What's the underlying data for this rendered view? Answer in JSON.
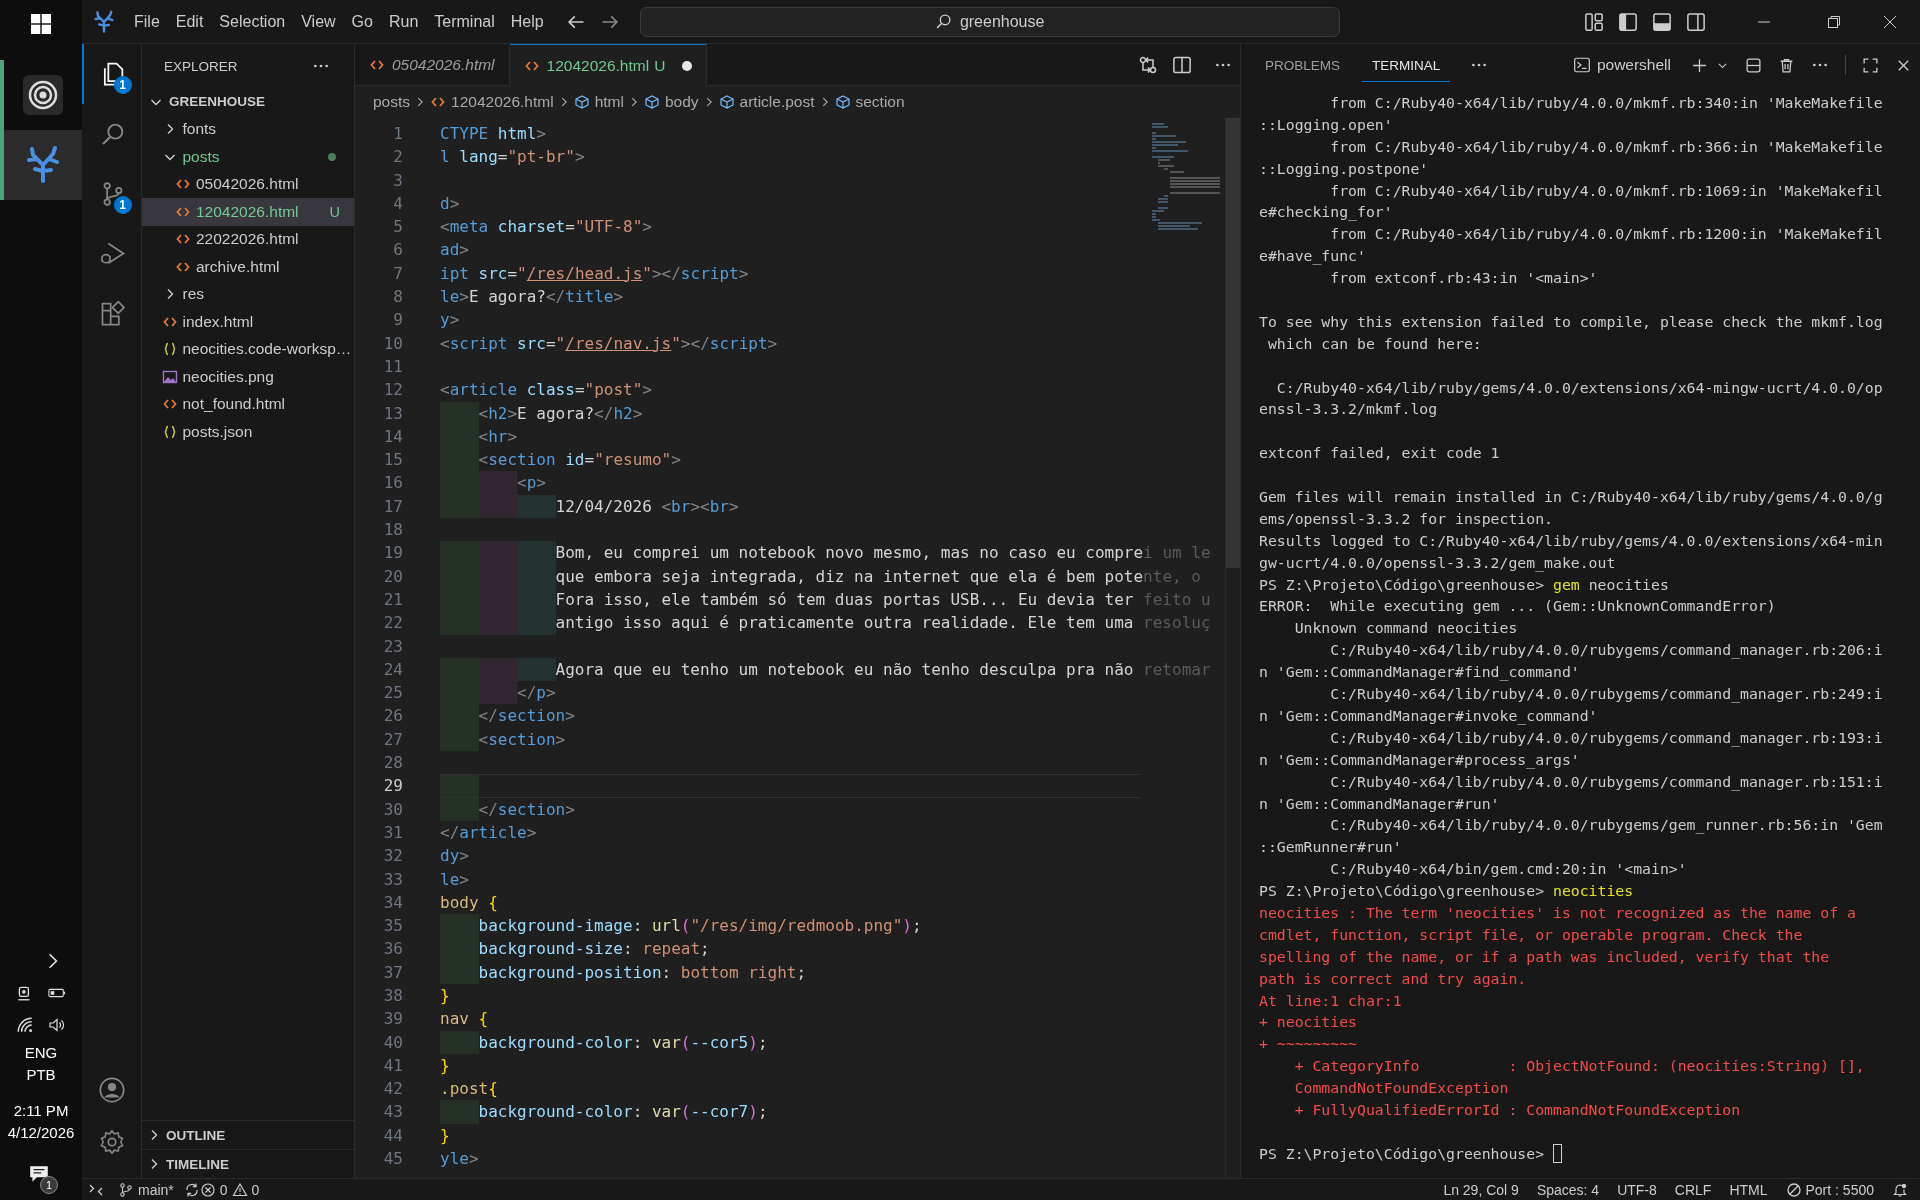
{
  "taskbar": {
    "apps": [
      {
        "kind": "rings",
        "active": false
      },
      {
        "kind": "coral",
        "active": true
      }
    ],
    "tray": {
      "language": "ENG",
      "layout": "PTB",
      "time": "2:11 PM",
      "date": "4/12/2026",
      "notifications": "1"
    }
  },
  "title_bar": {
    "menu": [
      "File",
      "Edit",
      "Selection",
      "View",
      "Go",
      "Run",
      "Terminal",
      "Help"
    ],
    "search": "greenhouse"
  },
  "activity_bar": {
    "items": [
      {
        "kind": "explorer",
        "selected": true,
        "badge": "1"
      },
      {
        "kind": "search",
        "selected": false
      },
      {
        "kind": "source-control",
        "selected": false,
        "badge": "1"
      },
      {
        "kind": "run",
        "selected": false
      },
      {
        "kind": "extensions",
        "selected": false
      }
    ]
  },
  "sidebar": {
    "title": "EXPLORER",
    "root": {
      "name": "GREENHOUSE",
      "expanded": true,
      "children": [
        {
          "name": "fonts",
          "kind": "folder",
          "expanded": false,
          "selected": false,
          "untracked": false
        },
        {
          "name": "posts",
          "kind": "folder",
          "expanded": true,
          "selected": false,
          "untracked": true,
          "children": [
            {
              "name": "05042026.html",
              "kind": "html",
              "selected": false,
              "untracked": false
            },
            {
              "name": "12042026.html",
              "kind": "html",
              "selected": true,
              "untracked": true,
              "badge": "U"
            },
            {
              "name": "22022026.html",
              "kind": "html",
              "selected": false,
              "untracked": false
            },
            {
              "name": "archive.html",
              "kind": "html",
              "selected": false,
              "untracked": false
            }
          ]
        },
        {
          "name": "res",
          "kind": "folder",
          "expanded": false,
          "selected": false,
          "untracked": false
        },
        {
          "name": "index.html",
          "kind": "html",
          "selected": false,
          "untracked": false
        },
        {
          "name": "neocities.code-worksp…",
          "kind": "json",
          "selected": false,
          "untracked": false
        },
        {
          "name": "neocities.png",
          "kind": "image",
          "selected": false,
          "untracked": false
        },
        {
          "name": "not_found.html",
          "kind": "html",
          "selected": false,
          "untracked": false
        },
        {
          "name": "posts.json",
          "kind": "json",
          "selected": false,
          "untracked": false
        }
      ]
    },
    "sections": [
      {
        "title": "OUTLINE",
        "expanded": false
      },
      {
        "title": "TIMELINE",
        "expanded": false
      }
    ]
  },
  "editor": {
    "tabs": [
      {
        "label": "05042026.html",
        "selected": false,
        "preview": true,
        "dirty": false
      },
      {
        "label": "12042026.html",
        "selected": true,
        "preview": false,
        "dirty": true,
        "status": "U"
      }
    ],
    "breadcrumbs": [
      {
        "label": "posts",
        "kind": "folder"
      },
      {
        "label": "12042026.html",
        "kind": "file"
      },
      {
        "label": "html",
        "kind": "symbol"
      },
      {
        "label": "body",
        "kind": "symbol"
      },
      {
        "label": "article.post",
        "kind": "symbol"
      },
      {
        "label": "section",
        "kind": "symbol"
      }
    ],
    "lines": [
      {
        "number": "1",
        "current": false,
        "tokens": [
          {
            "text": "CTYPE",
            "kind": "tag"
          },
          {
            "text": " html",
            "kind": "attr"
          },
          {
            "text": ">",
            "kind": "punct"
          }
        ]
      },
      {
        "number": "2",
        "current": false,
        "tokens": [
          {
            "text": "l",
            "kind": "tag"
          },
          {
            "text": " lang",
            "kind": "attr"
          },
          {
            "text": "=",
            "kind": "text"
          },
          {
            "text": "\"pt-br\"",
            "kind": "str"
          },
          {
            "text": ">",
            "kind": "punct"
          }
        ]
      },
      {
        "number": "3",
        "current": false
      },
      {
        "number": "4",
        "current": false,
        "tokens": [
          {
            "text": "d",
            "kind": "tag"
          },
          {
            "text": ">",
            "kind": "punct"
          }
        ]
      },
      {
        "number": "5",
        "current": false,
        "tokens": [
          {
            "text": "<",
            "kind": "punct"
          },
          {
            "text": "meta",
            "kind": "tag"
          },
          {
            "text": " charset",
            "kind": "attr"
          },
          {
            "text": "=",
            "kind": "text"
          },
          {
            "text": "\"UTF-8\"",
            "kind": "str"
          },
          {
            "text": ">",
            "kind": "punct"
          }
        ]
      },
      {
        "number": "6",
        "current": false,
        "tokens": [
          {
            "text": "ad",
            "kind": "tag"
          },
          {
            "text": ">",
            "kind": "punct"
          }
        ]
      },
      {
        "number": "7",
        "current": false,
        "tokens": [
          {
            "text": "ipt",
            "kind": "tag"
          },
          {
            "text": " src",
            "kind": "attr"
          },
          {
            "text": "=",
            "kind": "text"
          },
          {
            "text": "\"",
            "kind": "str"
          },
          {
            "text": "/res/head.js",
            "kind": "link"
          },
          {
            "text": "\"",
            "kind": "str"
          },
          {
            "text": "></",
            "kind": "punct"
          },
          {
            "text": "script",
            "kind": "tag"
          },
          {
            "text": ">",
            "kind": "punct"
          }
        ]
      },
      {
        "number": "8",
        "current": false,
        "tokens": [
          {
            "text": "le",
            "kind": "tag"
          },
          {
            "text": ">",
            "kind": "punct"
          },
          {
            "text": "E agora?",
            "kind": "text"
          },
          {
            "text": "</",
            "kind": "punct"
          },
          {
            "text": "title",
            "kind": "tag"
          },
          {
            "text": ">",
            "kind": "punct"
          }
        ]
      },
      {
        "number": "9",
        "current": false,
        "tokens": [
          {
            "text": "y",
            "kind": "tag"
          },
          {
            "text": ">",
            "kind": "punct"
          }
        ]
      },
      {
        "number": "10",
        "current": false,
        "tokens": [
          {
            "text": "<",
            "kind": "punct"
          },
          {
            "text": "script",
            "kind": "tag"
          },
          {
            "text": " src",
            "kind": "attr"
          },
          {
            "text": "=",
            "kind": "text"
          },
          {
            "text": "\"",
            "kind": "str"
          },
          {
            "text": "/res/nav.js",
            "kind": "link"
          },
          {
            "text": "\"",
            "kind": "str"
          },
          {
            "text": "></",
            "kind": "punct"
          },
          {
            "text": "script",
            "kind": "tag"
          },
          {
            "text": ">",
            "kind": "punct"
          }
        ]
      },
      {
        "number": "11",
        "current": false
      },
      {
        "number": "12",
        "current": false,
        "tokens": [
          {
            "text": "<",
            "kind": "punct"
          },
          {
            "text": "article",
            "kind": "tag"
          },
          {
            "text": " class",
            "kind": "attr"
          },
          {
            "text": "=",
            "kind": "text"
          },
          {
            "text": "\"post\"",
            "kind": "str"
          },
          {
            "text": ">",
            "kind": "punct"
          }
        ],
        "children": [
          {
            "number": "13",
            "current": false,
            "tokens": [
              {
                "text": "<",
                "kind": "punct"
              },
              {
                "text": "h2",
                "kind": "tag"
              },
              {
                "text": ">",
                "kind": "punct"
              },
              {
                "text": "E agora?",
                "kind": "text"
              },
              {
                "text": "</",
                "kind": "punct"
              },
              {
                "text": "h2",
                "kind": "tag"
              },
              {
                "text": ">",
                "kind": "punct"
              }
            ]
          },
          {
            "number": "14",
            "current": false,
            "tokens": [
              {
                "text": "<",
                "kind": "punct"
              },
              {
                "text": "hr",
                "kind": "tag"
              },
              {
                "text": ">",
                "kind": "punct"
              }
            ]
          },
          {
            "number": "15",
            "current": false,
            "tokens": [
              {
                "text": "<",
                "kind": "punct"
              },
              {
                "text": "section",
                "kind": "tag"
              },
              {
                "text": " id",
                "kind": "attr"
              },
              {
                "text": "=",
                "kind": "text"
              },
              {
                "text": "\"resumo\"",
                "kind": "str"
              },
              {
                "text": ">",
                "kind": "punct"
              }
            ],
            "children": [
              {
                "number": "16",
                "current": false,
                "tokens": [
                  {
                    "text": "<",
                    "kind": "punct"
                  },
                  {
                    "text": "p",
                    "kind": "tag"
                  },
                  {
                    "text": ">",
                    "kind": "punct"
                  }
                ],
                "children": [
                  {
                    "number": "17",
                    "current": false,
                    "tokens": [
                      {
                        "text": "12/04/2026 ",
                        "kind": "text"
                      },
                      {
                        "text": "<",
                        "kind": "punct"
                      },
                      {
                        "text": "br",
                        "kind": "tag"
                      },
                      {
                        "text": "><",
                        "kind": "punct"
                      },
                      {
                        "text": "br",
                        "kind": "tag"
                      },
                      {
                        "text": ">",
                        "kind": "punct"
                      }
                    ]
                  },
                  {
                    "number": "18",
                    "current": false
                  },
                  {
                    "number": "19",
                    "current": false,
                    "tokens": [
                      {
                        "text": "Bom, eu comprei um notebook novo mesmo, mas no caso eu compre",
                        "kind": "text"
                      },
                      {
                        "text": "i um le",
                        "kind": "dim"
                      }
                    ]
                  },
                  {
                    "number": "20",
                    "current": false,
                    "tokens": [
                      {
                        "text": "que embora seja integrada, diz na internet que ela é bem pote",
                        "kind": "text"
                      },
                      {
                        "text": "nte, o",
                        "kind": "dim"
                      }
                    ]
                  },
                  {
                    "number": "21",
                    "current": false,
                    "tokens": [
                      {
                        "text": "Fora isso, ele também só tem duas portas USB... Eu devia ter",
                        "kind": "text"
                      },
                      {
                        "text": " feito u",
                        "kind": "dim"
                      }
                    ]
                  },
                  {
                    "number": "22",
                    "current": false,
                    "tokens": [
                      {
                        "text": "antigo isso aqui é praticamente outra realidade. Ele tem uma",
                        "kind": "text"
                      },
                      {
                        "text": " resoluç",
                        "kind": "dim"
                      }
                    ]
                  },
                  {
                    "number": "23",
                    "current": false
                  },
                  {
                    "number": "24",
                    "current": false,
                    "tokens": [
                      {
                        "text": "Agora que eu tenho um notebook eu não tenho desculpa pra não",
                        "kind": "text"
                      },
                      {
                        "text": " retomar",
                        "kind": "dim"
                      }
                    ]
                  }
                ]
              },
              {
                "number": "25",
                "current": false,
                "tokens": [
                  {
                    "text": "</",
                    "kind": "punct"
                  },
                  {
                    "text": "p",
                    "kind": "tag"
                  },
                  {
                    "text": ">",
                    "kind": "punct"
                  }
                ]
              }
            ]
          },
          {
            "number": "26",
            "current": false,
            "tokens": [
              {
                "text": "</",
                "kind": "punct"
              },
              {
                "text": "section",
                "kind": "tag"
              },
              {
                "text": ">",
                "kind": "punct"
              }
            ]
          },
          {
            "number": "27",
            "current": false,
            "tokens": [
              {
                "text": "<",
                "kind": "punct"
              },
              {
                "text": "section",
                "kind": "tag"
              },
              {
                "text": ">",
                "kind": "punct"
              }
            ]
          },
          {
            "number": "28",
            "current": false
          },
          {
            "number": "29",
            "current": true
          },
          {
            "number": "30",
            "current": false,
            "tokens": [
              {
                "text": "</",
                "kind": "punct"
              },
              {
                "text": "section",
                "kind": "tag"
              },
              {
                "text": ">",
                "kind": "punct"
              }
            ]
          }
        ]
      },
      {
        "number": "31",
        "current": false,
        "tokens": [
          {
            "text": "</",
            "kind": "punct"
          },
          {
            "text": "article",
            "kind": "tag"
          },
          {
            "text": ">",
            "kind": "punct"
          }
        ]
      },
      {
        "number": "32",
        "current": false,
        "tokens": [
          {
            "text": "dy",
            "kind": "tag"
          },
          {
            "text": ">",
            "kind": "punct"
          }
        ]
      },
      {
        "number": "33",
        "current": false,
        "tokens": [
          {
            "text": "le",
            "kind": "tag"
          },
          {
            "text": ">",
            "kind": "punct"
          }
        ]
      },
      {
        "number": "34",
        "current": false,
        "tokens": [
          {
            "text": "body",
            "kind": "sel"
          },
          {
            "text": " {",
            "kind": "brace"
          }
        ],
        "children": [
          {
            "number": "35",
            "current": false,
            "tokens": [
              {
                "text": "background-image",
                "kind": "prop"
              },
              {
                "text": ": ",
                "kind": "text"
              },
              {
                "text": "url",
                "kind": "fn"
              },
              {
                "text": "(",
                "kind": "paren"
              },
              {
                "text": "\"/res/img/redmoob.png\"",
                "kind": "str"
              },
              {
                "text": ")",
                "kind": "paren"
              },
              {
                "text": ";",
                "kind": "text"
              }
            ]
          },
          {
            "number": "36",
            "current": false,
            "tokens": [
              {
                "text": "background-size",
                "kind": "prop"
              },
              {
                "text": ": ",
                "kind": "text"
              },
              {
                "text": "repeat",
                "kind": "str"
              },
              {
                "text": ";",
                "kind": "text"
              }
            ]
          },
          {
            "number": "37",
            "current": false,
            "tokens": [
              {
                "text": "background-position",
                "kind": "prop"
              },
              {
                "text": ": ",
                "kind": "text"
              },
              {
                "text": "bottom right",
                "kind": "str"
              },
              {
                "text": ";",
                "kind": "text"
              }
            ]
          }
        ]
      },
      {
        "number": "38",
        "current": false,
        "tokens": [
          {
            "text": "}",
            "kind": "brace"
          }
        ]
      },
      {
        "number": "39",
        "current": false,
        "tokens": [
          {
            "text": "nav",
            "kind": "sel"
          },
          {
            "text": " {",
            "kind": "brace"
          }
        ],
        "children": [
          {
            "number": "40",
            "current": false,
            "tokens": [
              {
                "text": "background-color",
                "kind": "prop"
              },
              {
                "text": ": ",
                "kind": "text"
              },
              {
                "text": "var",
                "kind": "fn"
              },
              {
                "text": "(",
                "kind": "paren"
              },
              {
                "text": "--cor5",
                "kind": "prop"
              },
              {
                "text": ")",
                "kind": "paren"
              },
              {
                "text": ";",
                "kind": "text"
              }
            ]
          }
        ]
      },
      {
        "number": "41",
        "current": false,
        "tokens": [
          {
            "text": "}",
            "kind": "brace"
          }
        ]
      },
      {
        "number": "42",
        "current": false,
        "tokens": [
          {
            "text": ".post",
            "kind": "sel"
          },
          {
            "text": "{",
            "kind": "brace"
          }
        ],
        "children": [
          {
            "number": "43",
            "current": false,
            "tokens": [
              {
                "text": "background-color",
                "kind": "prop"
              },
              {
                "text": ": ",
                "kind": "text"
              },
              {
                "text": "var",
                "kind": "fn"
              },
              {
                "text": "(",
                "kind": "paren"
              },
              {
                "text": "--cor7",
                "kind": "prop"
              },
              {
                "text": ")",
                "kind": "paren"
              },
              {
                "text": ";",
                "kind": "text"
              }
            ]
          }
        ]
      },
      {
        "number": "44",
        "current": false,
        "tokens": [
          {
            "text": "}",
            "kind": "brace"
          }
        ]
      },
      {
        "number": "45",
        "current": false,
        "tokens": [
          {
            "text": "yle",
            "kind": "tag"
          },
          {
            "text": ">",
            "kind": "punct"
          }
        ]
      }
    ]
  },
  "panel": {
    "tabs": [
      {
        "label": "PROBLEMS",
        "selected": false
      },
      {
        "label": "TERMINAL",
        "selected": true
      }
    ],
    "shell": "powershell",
    "lines": [
      {
        "kind": "output",
        "text": "        from C:/Ruby40-x64/lib/ruby/4.0.0/mkmf.rb:340:in 'MakeMakefile"
      },
      {
        "kind": "output",
        "text": "::Logging.open'"
      },
      {
        "kind": "output",
        "text": "        from C:/Ruby40-x64/lib/ruby/4.0.0/mkmf.rb:366:in 'MakeMakefile"
      },
      {
        "kind": "output",
        "text": "::Logging.postpone'"
      },
      {
        "kind": "output",
        "text": "        from C:/Ruby40-x64/lib/ruby/4.0.0/mkmf.rb:1069:in 'MakeMakefil"
      },
      {
        "kind": "output",
        "text": "e#checking_for'"
      },
      {
        "kind": "output",
        "text": "        from C:/Ruby40-x64/lib/ruby/4.0.0/mkmf.rb:1200:in 'MakeMakefil"
      },
      {
        "kind": "output",
        "text": "e#have_func'"
      },
      {
        "kind": "output",
        "text": "        from extconf.rb:43:in '<main>'"
      },
      {
        "kind": "blank"
      },
      {
        "kind": "output",
        "text": "To see why this extension failed to compile, please check the mkmf.log"
      },
      {
        "kind": "output",
        "text": " which can be found here:"
      },
      {
        "kind": "blank"
      },
      {
        "kind": "output",
        "text": "  C:/Ruby40-x64/lib/ruby/gems/4.0.0/extensions/x64-mingw-ucrt/4.0.0/op"
      },
      {
        "kind": "output",
        "text": "enssl-3.3.2/mkmf.log"
      },
      {
        "kind": "blank"
      },
      {
        "kind": "output",
        "text": "extconf failed, exit code 1"
      },
      {
        "kind": "blank"
      },
      {
        "kind": "output",
        "text": "Gem files will remain installed in C:/Ruby40-x64/lib/ruby/gems/4.0.0/g"
      },
      {
        "kind": "output",
        "text": "ems/openssl-3.3.2 for inspection."
      },
      {
        "kind": "output",
        "text": "Results logged to C:/Ruby40-x64/lib/ruby/gems/4.0.0/extensions/x64-min"
      },
      {
        "kind": "output",
        "text": "gw-ucrt/4.0.0/openssl-3.3.2/gem_make.out"
      },
      {
        "kind": "prompt",
        "prompt": "PS Z:\\Projeto\\Código\\greenhouse> ",
        "command": "gem",
        "args": " neocities",
        "cursor": false
      },
      {
        "kind": "output",
        "text": "ERROR:  While executing gem ... (Gem::UnknownCommandError)"
      },
      {
        "kind": "output",
        "text": "    Unknown command neocities"
      },
      {
        "kind": "output",
        "text": "        C:/Ruby40-x64/lib/ruby/4.0.0/rubygems/command_manager.rb:206:i"
      },
      {
        "kind": "output",
        "text": "n 'Gem::CommandManager#find_command'"
      },
      {
        "kind": "output",
        "text": "        C:/Ruby40-x64/lib/ruby/4.0.0/rubygems/command_manager.rb:249:i"
      },
      {
        "kind": "output",
        "text": "n 'Gem::CommandManager#invoke_command'"
      },
      {
        "kind": "output",
        "text": "        C:/Ruby40-x64/lib/ruby/4.0.0/rubygems/command_manager.rb:193:i"
      },
      {
        "kind": "output",
        "text": "n 'Gem::CommandManager#process_args'"
      },
      {
        "kind": "output",
        "text": "        C:/Ruby40-x64/lib/ruby/4.0.0/rubygems/command_manager.rb:151:i"
      },
      {
        "kind": "output",
        "text": "n 'Gem::CommandManager#run'"
      },
      {
        "kind": "output",
        "text": "        C:/Ruby40-x64/lib/ruby/4.0.0/rubygems/gem_runner.rb:56:in 'Gem"
      },
      {
        "kind": "output",
        "text": "::GemRunner#run'"
      },
      {
        "kind": "output",
        "text": "        C:/Ruby40-x64/bin/gem.cmd:20:in '<main>'"
      },
      {
        "kind": "prompt",
        "prompt": "PS Z:\\Projeto\\Código\\greenhouse> ",
        "command": "neocities",
        "cursor": false
      },
      {
        "kind": "error",
        "text": "neocities : The term 'neocities' is not recognized as the name of a"
      },
      {
        "kind": "error",
        "text": "cmdlet, function, script file, or operable program. Check the"
      },
      {
        "kind": "error",
        "text": "spelling of the name, or if a path was included, verify that the"
      },
      {
        "kind": "error",
        "text": "path is correct and try again."
      },
      {
        "kind": "error",
        "text": "At line:1 char:1"
      },
      {
        "kind": "error",
        "text": "+ neocities"
      },
      {
        "kind": "error",
        "text": "+ ~~~~~~~~~"
      },
      {
        "kind": "error",
        "text": "    + CategoryInfo          : ObjectNotFound: (neocities:String) [],"
      },
      {
        "kind": "error",
        "text": "    CommandNotFoundException"
      },
      {
        "kind": "error",
        "text": "    + FullyQualifiedErrorId : CommandNotFoundException"
      },
      {
        "kind": "blank"
      },
      {
        "kind": "prompt",
        "prompt": "PS Z:\\Projeto\\Código\\greenhouse> ",
        "cursor": true
      }
    ]
  },
  "status_bar": {
    "branch": "main*",
    "errors": "0",
    "warnings": "0",
    "items": [
      "Ln 29, Col 9",
      "Spaces: 4",
      "UTF-8",
      "CRLF",
      "HTML"
    ],
    "port": "Port : 5500"
  }
}
